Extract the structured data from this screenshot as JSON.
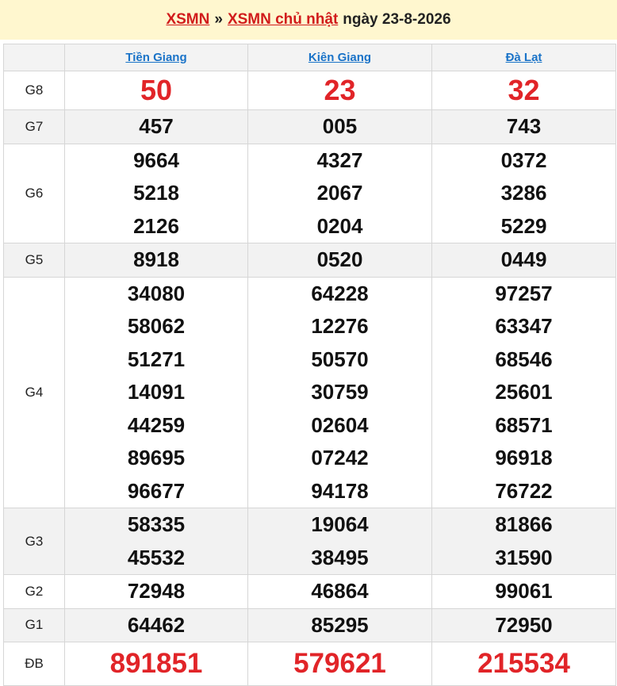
{
  "header": {
    "link1": "XSMN",
    "separator": "»",
    "link2": "XSMN chủ nhật",
    "date_text": "ngày 23-8-2026"
  },
  "provinces": [
    "Tiền Giang",
    "Kiên Giang",
    "Đà Lạt"
  ],
  "prizes": [
    {
      "label": "G8",
      "style": "big",
      "alt": false,
      "values": [
        [
          "50"
        ],
        [
          "23"
        ],
        [
          "32"
        ]
      ]
    },
    {
      "label": "G7",
      "style": "normal",
      "alt": true,
      "values": [
        [
          "457"
        ],
        [
          "005"
        ],
        [
          "743"
        ]
      ]
    },
    {
      "label": "G6",
      "style": "normal",
      "alt": false,
      "values": [
        [
          "9664",
          "5218",
          "2126"
        ],
        [
          "4327",
          "2067",
          "0204"
        ],
        [
          "0372",
          "3286",
          "5229"
        ]
      ]
    },
    {
      "label": "G5",
      "style": "normal",
      "alt": true,
      "values": [
        [
          "8918"
        ],
        [
          "0520"
        ],
        [
          "0449"
        ]
      ]
    },
    {
      "label": "G4",
      "style": "normal",
      "alt": false,
      "values": [
        [
          "34080",
          "58062",
          "51271",
          "14091",
          "44259",
          "89695",
          "96677"
        ],
        [
          "64228",
          "12276",
          "50570",
          "30759",
          "02604",
          "07242",
          "94178"
        ],
        [
          "97257",
          "63347",
          "68546",
          "25601",
          "68571",
          "96918",
          "76722"
        ]
      ]
    },
    {
      "label": "G3",
      "style": "normal",
      "alt": true,
      "values": [
        [
          "58335",
          "45532"
        ],
        [
          "19064",
          "38495"
        ],
        [
          "81866",
          "31590"
        ]
      ]
    },
    {
      "label": "G2",
      "style": "normal",
      "alt": false,
      "values": [
        [
          "72948"
        ],
        [
          "46864"
        ],
        [
          "99061"
        ]
      ]
    },
    {
      "label": "G1",
      "style": "normal",
      "alt": true,
      "values": [
        [
          "64462"
        ],
        [
          "85295"
        ],
        [
          "72950"
        ]
      ]
    },
    {
      "label": "ĐB",
      "style": "special",
      "alt": false,
      "values": [
        [
          "891851"
        ],
        [
          "579621"
        ],
        [
          "215534"
        ]
      ]
    }
  ],
  "colors": {
    "header_bg": "#fff7cf",
    "link_red": "#d11c1c",
    "province_blue": "#1a73c8",
    "prize_red": "#e12428",
    "alt_row": "#f2f2f2"
  }
}
